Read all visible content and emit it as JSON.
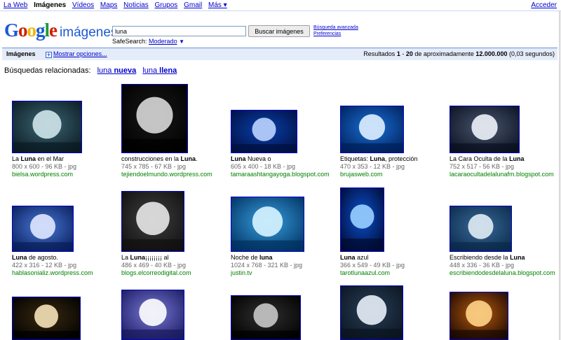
{
  "topnav": {
    "items": [
      "La Web",
      "Imágenes",
      "Vídeos",
      "Maps",
      "Noticias",
      "Grupos",
      "Gmail",
      "Más ▾"
    ],
    "signin": "Acceder"
  },
  "header": {
    "logo": "Google",
    "logo_sub": "imágenes",
    "search_value": "luna",
    "search_button": "Buscar imágenes",
    "advanced_search": "Búsqueda avanzada",
    "preferences": "Preferencias",
    "safesearch_label": "SafeSearch:",
    "safesearch_value": "Moderado",
    "safesearch_arrow": "▼"
  },
  "results_bar": {
    "title": "Imágenes",
    "options": "Mostrar opciones...",
    "summary_a": "Resultados ",
    "range_start": "1",
    "range_sep": " - ",
    "range_end": "20",
    "summary_b": " de aproximadamente ",
    "total": "12.000.000",
    "summary_c": " (0,03 segundos)"
  },
  "related": {
    "label": "Búsquedas relacionadas:",
    "items": [
      {
        "plain": "luna ",
        "bold": "nueva"
      },
      {
        "plain": "luna ",
        "bold": "llena"
      }
    ]
  },
  "results": [
    {
      "pre": "La ",
      "bold": "Luna",
      "post": " en el Mar",
      "meta": "800 x 600 - 96 KB - jpg",
      "site": "bielsa.wordpress.com"
    },
    {
      "pre": "construcciones en la ",
      "bold": "Luna",
      "post": ".",
      "meta": "745 x 785 - 67 KB - jpg",
      "site": "tejiendoelmundo.wordpress.com"
    },
    {
      "pre": "",
      "bold": "Luna",
      "post": " Nueva o",
      "meta": "605 x 400 - 18 KB - jpg",
      "site": "tamaraashtangayoga.blogspot.com"
    },
    {
      "pre": "Etiquetas: ",
      "bold": "Luna",
      "post": ", protección",
      "meta": "470 x 353 - 12 KB - jpg",
      "site": "brujasweb.com"
    },
    {
      "pre": "La Cara Oculta de la ",
      "bold": "Luna",
      "post": "",
      "meta": "752 x 517 - 56 KB - jpg",
      "site": "lacaraocultadelalunafm.blogspot.com"
    },
    {
      "pre": "",
      "bold": "Luna",
      "post": " de agosto.",
      "meta": "422 x 316 - 12 KB - jpg",
      "site": "hablasonializ.wordpress.com"
    },
    {
      "pre": "La ",
      "bold": "Luna",
      "post": "¡¡¡¡¡¡¡¡ al",
      "meta": "486 x 469 - 40 KB - jpg",
      "site": "blogs.elcorreodigital.com"
    },
    {
      "pre": "Noche de ",
      "bold": "luna",
      "post": "",
      "meta": "1024 x 768 - 321 KB - jpg",
      "site": "justin.tv"
    },
    {
      "pre": "",
      "bold": "Luna",
      "post": " azul",
      "meta": "366 x 549 - 49 KB - jpg",
      "site": "tarotlunaazul.com"
    },
    {
      "pre": "Escribiendo desde la ",
      "bold": "Luna",
      "post": "",
      "meta": "448 x 336 - 36 KB - jpg",
      "site": "escribiendodesdelaluna.blogspot.com"
    },
    {
      "pre": "",
      "bold": "",
      "post": "",
      "meta": "",
      "site": ""
    },
    {
      "pre": "",
      "bold": "",
      "post": "",
      "meta": "",
      "site": ""
    },
    {
      "pre": "",
      "bold": "",
      "post": "",
      "meta": "",
      "site": ""
    },
    {
      "pre": "",
      "bold": "",
      "post": "",
      "meta": "",
      "site": ""
    },
    {
      "pre": "",
      "bold": "",
      "post": "",
      "meta": "",
      "site": ""
    }
  ],
  "colors": {
    "link": "#0000cc",
    "site_url": "#008000",
    "results_bar_bg": "#e5ecf9"
  }
}
